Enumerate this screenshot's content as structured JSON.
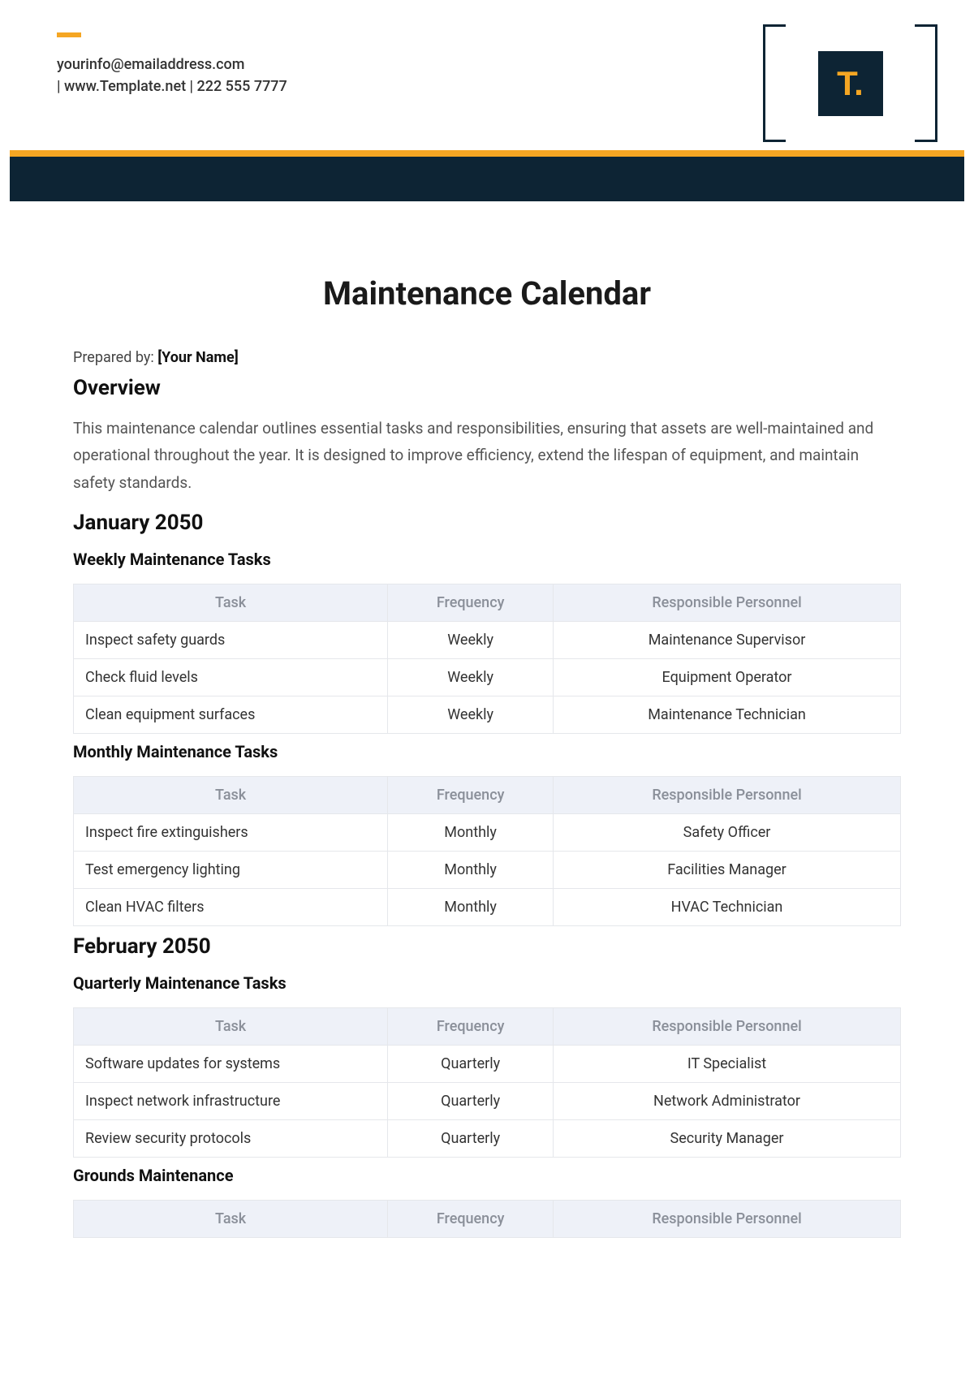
{
  "header": {
    "contact_line1": "yourinfo@emailaddress.com",
    "contact_line2": "|  www.Template.net  |  222 555 7777",
    "logo_text": "T."
  },
  "title": "Maintenance Calendar",
  "prepared_by_label": "Prepared by: ",
  "prepared_by_value": "[Your Name]",
  "overview_heading": "Overview",
  "overview_body": "This maintenance calendar outlines essential tasks and responsibilities, ensuring that assets are well-maintained and operational throughout the year. It is designed to improve efficiency, extend the lifespan of equipment, and maintain safety standards.",
  "columns": {
    "task": "Task",
    "freq": "Frequency",
    "resp": "Responsible Personnel"
  },
  "sections": [
    {
      "heading": "January 2050",
      "subs": [
        {
          "title": "Weekly Maintenance Tasks",
          "rows": [
            {
              "task": "Inspect safety guards",
              "freq": "Weekly",
              "resp": "Maintenance Supervisor"
            },
            {
              "task": "Check fluid levels",
              "freq": "Weekly",
              "resp": "Equipment Operator"
            },
            {
              "task": "Clean equipment surfaces",
              "freq": "Weekly",
              "resp": "Maintenance Technician"
            }
          ]
        },
        {
          "title": "Monthly Maintenance Tasks",
          "rows": [
            {
              "task": "Inspect fire extinguishers",
              "freq": "Monthly",
              "resp": "Safety Officer"
            },
            {
              "task": "Test emergency lighting",
              "freq": "Monthly",
              "resp": "Facilities Manager"
            },
            {
              "task": "Clean HVAC filters",
              "freq": "Monthly",
              "resp": "HVAC Technician"
            }
          ]
        }
      ]
    },
    {
      "heading": "February 2050",
      "subs": [
        {
          "title": "Quarterly Maintenance Tasks",
          "rows": [
            {
              "task": "Software updates for systems",
              "freq": "Quarterly",
              "resp": "IT Specialist"
            },
            {
              "task": "Inspect network infrastructure",
              "freq": "Quarterly",
              "resp": "Network Administrator"
            },
            {
              "task": "Review security protocols",
              "freq": "Quarterly",
              "resp": "Security Manager"
            }
          ]
        },
        {
          "title": "Grounds Maintenance",
          "rows": []
        }
      ]
    }
  ]
}
